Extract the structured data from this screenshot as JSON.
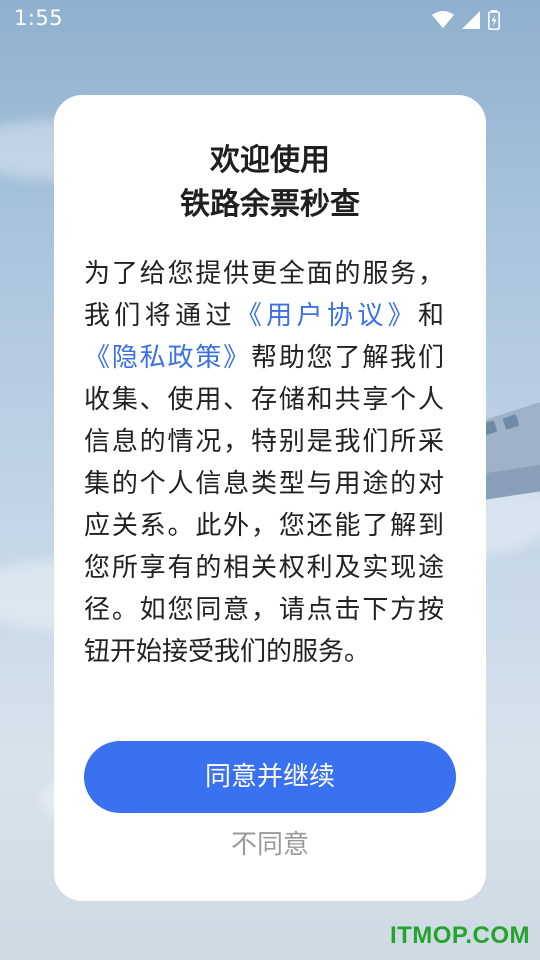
{
  "status_bar": {
    "time": "1:55"
  },
  "dialog": {
    "title_line1": "欢迎使用",
    "title_line2": "铁路余票秒查",
    "text_part1": "为了给您提供更全面的服务，我们将通过",
    "link_user_agreement": "《用户协议》",
    "text_and": "和",
    "link_privacy_policy": "《隐私政策》",
    "text_part2": "帮助您了解我们收集、使用、存储和共享个人信息的情况，特别是我们所采集的个人信息类型与用途的对应关系。此外，您还能了解到您所享有的相关权利及实现途径。如您同意，请点击下方按钮开始接受我们的服务。",
    "agree_button": "同意并继续",
    "disagree_button": "不同意"
  },
  "watermark": "ITMOP.COM",
  "colors": {
    "accent": "#3a71f0",
    "link": "#3a71e6",
    "watermark": "#22a52a"
  },
  "icons": [
    "wifi-icon",
    "cell-signal-icon",
    "battery-charging-icon"
  ]
}
